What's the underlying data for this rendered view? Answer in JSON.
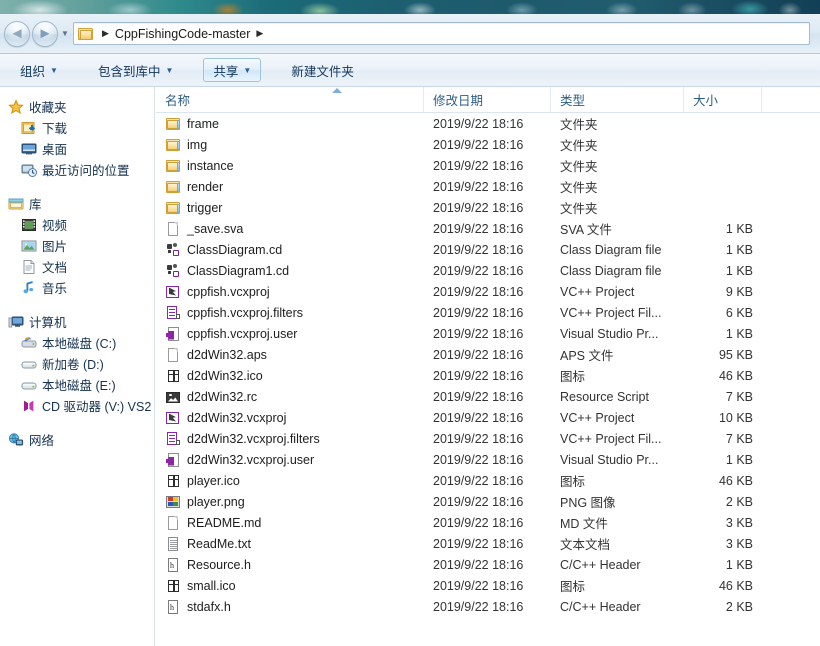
{
  "window": {
    "nav": {
      "back_label": "◄",
      "forward_label": "►",
      "history_caret": "▼",
      "breadcrumb_sep": "▶",
      "breadcrumb_path": "CppFishingCode-master",
      "breadcrumb_tail_sep": "▶"
    },
    "toolbar": {
      "organize_label": "组织",
      "include_in_library_label": "包含到库中",
      "share_label": "共享",
      "new_folder_label": "新建文件夹",
      "caret": "▼"
    }
  },
  "sidebar": {
    "groups": [
      {
        "header": {
          "label": "收藏夹",
          "icon": "star-icon"
        },
        "items": [
          {
            "label": "下载",
            "icon": "downloads-icon"
          },
          {
            "label": "桌面",
            "icon": "desktop-icon"
          },
          {
            "label": "最近访问的位置",
            "icon": "recent-places-icon"
          }
        ]
      },
      {
        "header": {
          "label": "库",
          "icon": "libraries-icon"
        },
        "items": [
          {
            "label": "视频",
            "icon": "videos-icon"
          },
          {
            "label": "图片",
            "icon": "pictures-icon"
          },
          {
            "label": "文档",
            "icon": "documents-icon"
          },
          {
            "label": "音乐",
            "icon": "music-icon"
          }
        ]
      },
      {
        "header": {
          "label": "计算机",
          "icon": "computer-icon"
        },
        "items": [
          {
            "label": "本地磁盘 (C:)",
            "icon": "system-drive-icon"
          },
          {
            "label": "新加卷 (D:)",
            "icon": "drive-icon"
          },
          {
            "label": "本地磁盘 (E:)",
            "icon": "drive-icon"
          },
          {
            "label": "CD 驱动器 (V:) VS2",
            "icon": "cd-drive-icon"
          }
        ]
      },
      {
        "header": {
          "label": "网络",
          "icon": "network-icon"
        },
        "items": []
      }
    ]
  },
  "filelist": {
    "columns": [
      {
        "key": "name",
        "label": "名称",
        "sorted": true,
        "sort_dir": "asc"
      },
      {
        "key": "date",
        "label": "修改日期"
      },
      {
        "key": "type",
        "label": "类型"
      },
      {
        "key": "size",
        "label": "大小"
      },
      {
        "key": "extra",
        "label": ""
      }
    ],
    "rows": [
      {
        "icon": "folder-icon",
        "name": "frame",
        "date": "2019/9/22 18:16",
        "type": "文件夹",
        "size": ""
      },
      {
        "icon": "folder-icon",
        "name": "img",
        "date": "2019/9/22 18:16",
        "type": "文件夹",
        "size": ""
      },
      {
        "icon": "folder-icon",
        "name": "instance",
        "date": "2019/9/22 18:16",
        "type": "文件夹",
        "size": ""
      },
      {
        "icon": "folder-icon",
        "name": "render",
        "date": "2019/9/22 18:16",
        "type": "文件夹",
        "size": ""
      },
      {
        "icon": "folder-icon",
        "name": "trigger",
        "date": "2019/9/22 18:16",
        "type": "文件夹",
        "size": ""
      },
      {
        "icon": "blank-file-icon",
        "name": "_save.sva",
        "date": "2019/9/22 18:16",
        "type": "SVA 文件",
        "size": "1 KB"
      },
      {
        "icon": "class-diagram-icon",
        "name": "ClassDiagram.cd",
        "date": "2019/9/22 18:16",
        "type": "Class Diagram file",
        "size": "1 KB"
      },
      {
        "icon": "class-diagram-icon",
        "name": "ClassDiagram1.cd",
        "date": "2019/9/22 18:16",
        "type": "Class Diagram file",
        "size": "1 KB"
      },
      {
        "icon": "vcxproj-icon",
        "name": "cppfish.vcxproj",
        "date": "2019/9/22 18:16",
        "type": "VC++ Project",
        "size": "9 KB"
      },
      {
        "icon": "vcxproj-filters-icon",
        "name": "cppfish.vcxproj.filters",
        "date": "2019/9/22 18:16",
        "type": "VC++ Project Fil...",
        "size": "6 KB"
      },
      {
        "icon": "vcxproj-user-icon",
        "name": "cppfish.vcxproj.user",
        "date": "2019/9/22 18:16",
        "type": "Visual Studio Pr...",
        "size": "1 KB"
      },
      {
        "icon": "blank-file-icon",
        "name": "d2dWin32.aps",
        "date": "2019/9/22 18:16",
        "type": "APS 文件",
        "size": "95 KB"
      },
      {
        "icon": "ico-file-icon",
        "name": "d2dWin32.ico",
        "date": "2019/9/22 18:16",
        "type": "图标",
        "size": "46 KB"
      },
      {
        "icon": "resource-script-icon",
        "name": "d2dWin32.rc",
        "date": "2019/9/22 18:16",
        "type": "Resource Script",
        "size": "7 KB"
      },
      {
        "icon": "vcxproj-icon",
        "name": "d2dWin32.vcxproj",
        "date": "2019/9/22 18:16",
        "type": "VC++ Project",
        "size": "10 KB"
      },
      {
        "icon": "vcxproj-filters-icon",
        "name": "d2dWin32.vcxproj.filters",
        "date": "2019/9/22 18:16",
        "type": "VC++ Project Fil...",
        "size": "7 KB"
      },
      {
        "icon": "vcxproj-user-icon",
        "name": "d2dWin32.vcxproj.user",
        "date": "2019/9/22 18:16",
        "type": "Visual Studio Pr...",
        "size": "1 KB"
      },
      {
        "icon": "ico-file-icon",
        "name": "player.ico",
        "date": "2019/9/22 18:16",
        "type": "图标",
        "size": "46 KB"
      },
      {
        "icon": "png-image-icon",
        "name": "player.png",
        "date": "2019/9/22 18:16",
        "type": "PNG 图像",
        "size": "2 KB"
      },
      {
        "icon": "blank-file-icon",
        "name": "README.md",
        "date": "2019/9/22 18:16",
        "type": "MD 文件",
        "size": "3 KB"
      },
      {
        "icon": "text-file-icon",
        "name": "ReadMe.txt",
        "date": "2019/9/22 18:16",
        "type": "文本文档",
        "size": "3 KB"
      },
      {
        "icon": "header-file-icon",
        "name": "Resource.h",
        "date": "2019/9/22 18:16",
        "type": "C/C++ Header",
        "size": "1 KB"
      },
      {
        "icon": "ico-file-icon",
        "name": "small.ico",
        "date": "2019/9/22 18:16",
        "type": "图标",
        "size": "46 KB"
      },
      {
        "icon": "header-file-icon",
        "name": "stdafx.h",
        "date": "2019/9/22 18:16",
        "type": "C/C++ Header",
        "size": "2 KB"
      }
    ]
  },
  "colors": {
    "header_text": "#2e5d87",
    "nav_text": "#14314f",
    "toolbar_text": "#12355b",
    "row_text": "#1d1d1d",
    "folder_yellow": "#edbe56",
    "vs_purple": "#8e24aa"
  }
}
